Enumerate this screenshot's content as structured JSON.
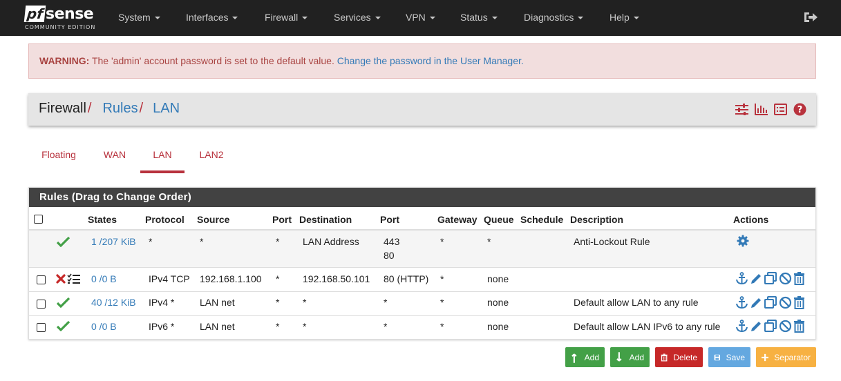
{
  "brand": {
    "name_part1": "pf",
    "name_part2": "sense",
    "edition": "COMMUNITY EDITION"
  },
  "nav": {
    "items": [
      {
        "label": "System"
      },
      {
        "label": "Interfaces"
      },
      {
        "label": "Firewall"
      },
      {
        "label": "Services"
      },
      {
        "label": "VPN"
      },
      {
        "label": "Status"
      },
      {
        "label": "Diagnostics"
      },
      {
        "label": "Help"
      }
    ],
    "logout_icon": "sign-out-icon"
  },
  "alert": {
    "prefix": "WARNING:",
    "message": " The 'admin' account password is set to the default value. ",
    "link": "Change the password in the User Manager."
  },
  "breadcrumb": {
    "items": [
      "Firewall",
      "Rules",
      "LAN"
    ],
    "separator": "/",
    "icons": [
      "sliders-icon",
      "bar-chart-icon",
      "list-alt-icon",
      "question-circle-icon"
    ]
  },
  "tabs": [
    {
      "label": "Floating",
      "active": false
    },
    {
      "label": "WAN",
      "active": false
    },
    {
      "label": "LAN",
      "active": true
    },
    {
      "label": "LAN2",
      "active": false
    }
  ],
  "rules": {
    "title": "Rules (Drag to Change Order)",
    "columns": [
      "States",
      "Protocol",
      "Source",
      "Port",
      "Destination",
      "Port",
      "Gateway",
      "Queue",
      "Schedule",
      "Description",
      "Actions"
    ],
    "rows": [
      {
        "status": "check",
        "states": "1 /207 KiB",
        "protocol": "*",
        "source": "*",
        "port": "*",
        "destination": "LAN Address",
        "dport_1": "443",
        "dport_2": "80",
        "gateway": "*",
        "queue": "*",
        "schedule": "",
        "description": "Anti-Lockout Rule"
      },
      {
        "status": "block",
        "states": "0 /0 B",
        "protocol": "IPv4 TCP",
        "source": "192.168.1.100",
        "port": "*",
        "destination": "192.168.50.101",
        "dport_1": "80 (HTTP)",
        "gateway": "*",
        "queue": "none",
        "schedule": "",
        "description": ""
      },
      {
        "status": "check",
        "states": "40 /12 KiB",
        "protocol": "IPv4 *",
        "source": "LAN net",
        "port": "*",
        "destination": "*",
        "dport_1": "*",
        "gateway": "*",
        "queue": "none",
        "schedule": "",
        "description": "Default allow LAN to any rule"
      },
      {
        "status": "check",
        "states": "0 /0 B",
        "protocol": "IPv6 *",
        "source": "LAN net",
        "port": "*",
        "destination": "*",
        "dport_1": "*",
        "gateway": "*",
        "queue": "none",
        "schedule": "",
        "description": "Default allow LAN IPv6 to any rule"
      }
    ]
  },
  "buttons": {
    "add_top": "Add",
    "add_bottom": "Add",
    "delete": "Delete",
    "save": "Save",
    "separator": "Separator"
  },
  "colors": {
    "accent": "#b8323d",
    "link": "#337ab7",
    "success": "#43a047",
    "danger": "#c62828",
    "save": "#64a8e0",
    "separator": "#f7b142"
  }
}
